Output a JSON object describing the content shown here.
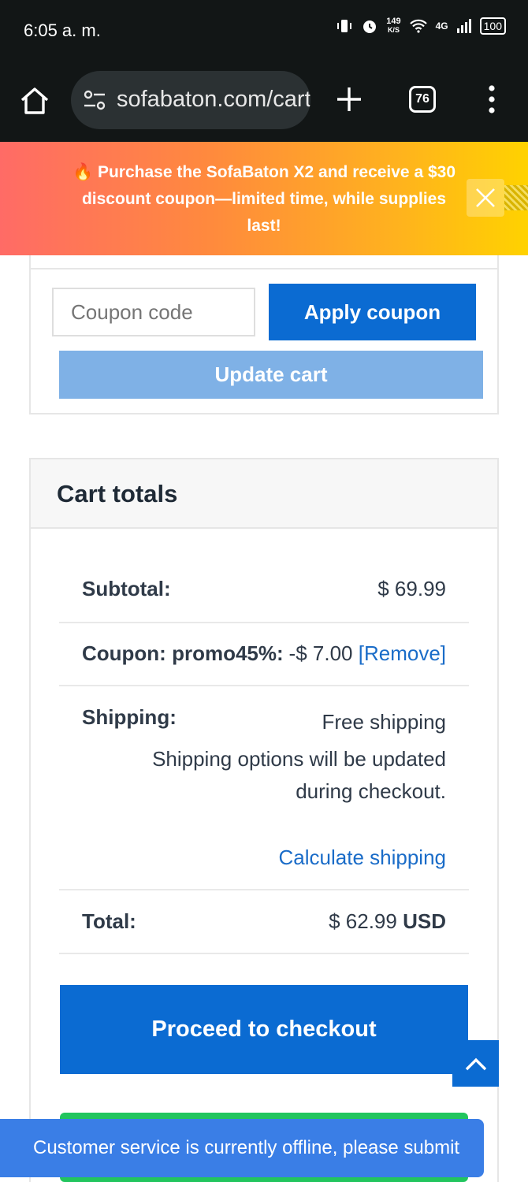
{
  "status_bar": {
    "time": "6:05 a. m.",
    "speed_value": "149",
    "speed_unit": "K/S",
    "network": "4G",
    "battery": "100"
  },
  "browser": {
    "url": "sofabaton.com/cart",
    "tab_count": "76",
    "icons": [
      "home-icon",
      "site-settings-icon",
      "new-tab-icon",
      "tabs-icon",
      "menu-icon"
    ]
  },
  "promo": {
    "emoji": "🔥",
    "text": "Purchase the SofaBaton X2 and receive a $30 discount coupon—limited time, while supplies last!"
  },
  "cart_actions": {
    "coupon_placeholder": "Coupon code",
    "apply_label": "Apply coupon",
    "update_label": "Update cart"
  },
  "totals": {
    "title": "Cart totals",
    "subtotal_label": "Subtotal:",
    "subtotal_value": "$ 69.99",
    "coupon_label": "Coupon: promo45%:",
    "coupon_value": "-$ 7.00",
    "coupon_remove": "[Remove]",
    "shipping_label": "Shipping:",
    "shipping_value": "Free shipping",
    "shipping_note_1": "Shipping options will be updated",
    "shipping_note_2": "during checkout.",
    "calculate_shipping": "Calculate shipping",
    "total_label": "Total:",
    "total_value": "$ 62.99",
    "total_currency": "USD",
    "checkout_label": "Proceed to checkout"
  },
  "chat": {
    "message": "Customer service is currently offline, please submit"
  },
  "colors": {
    "primary": "#0b6bd2",
    "update_disabled": "#7fb1e6",
    "link": "#1a6cc8",
    "chat": "#3a7ee6",
    "green": "#22c55e"
  }
}
